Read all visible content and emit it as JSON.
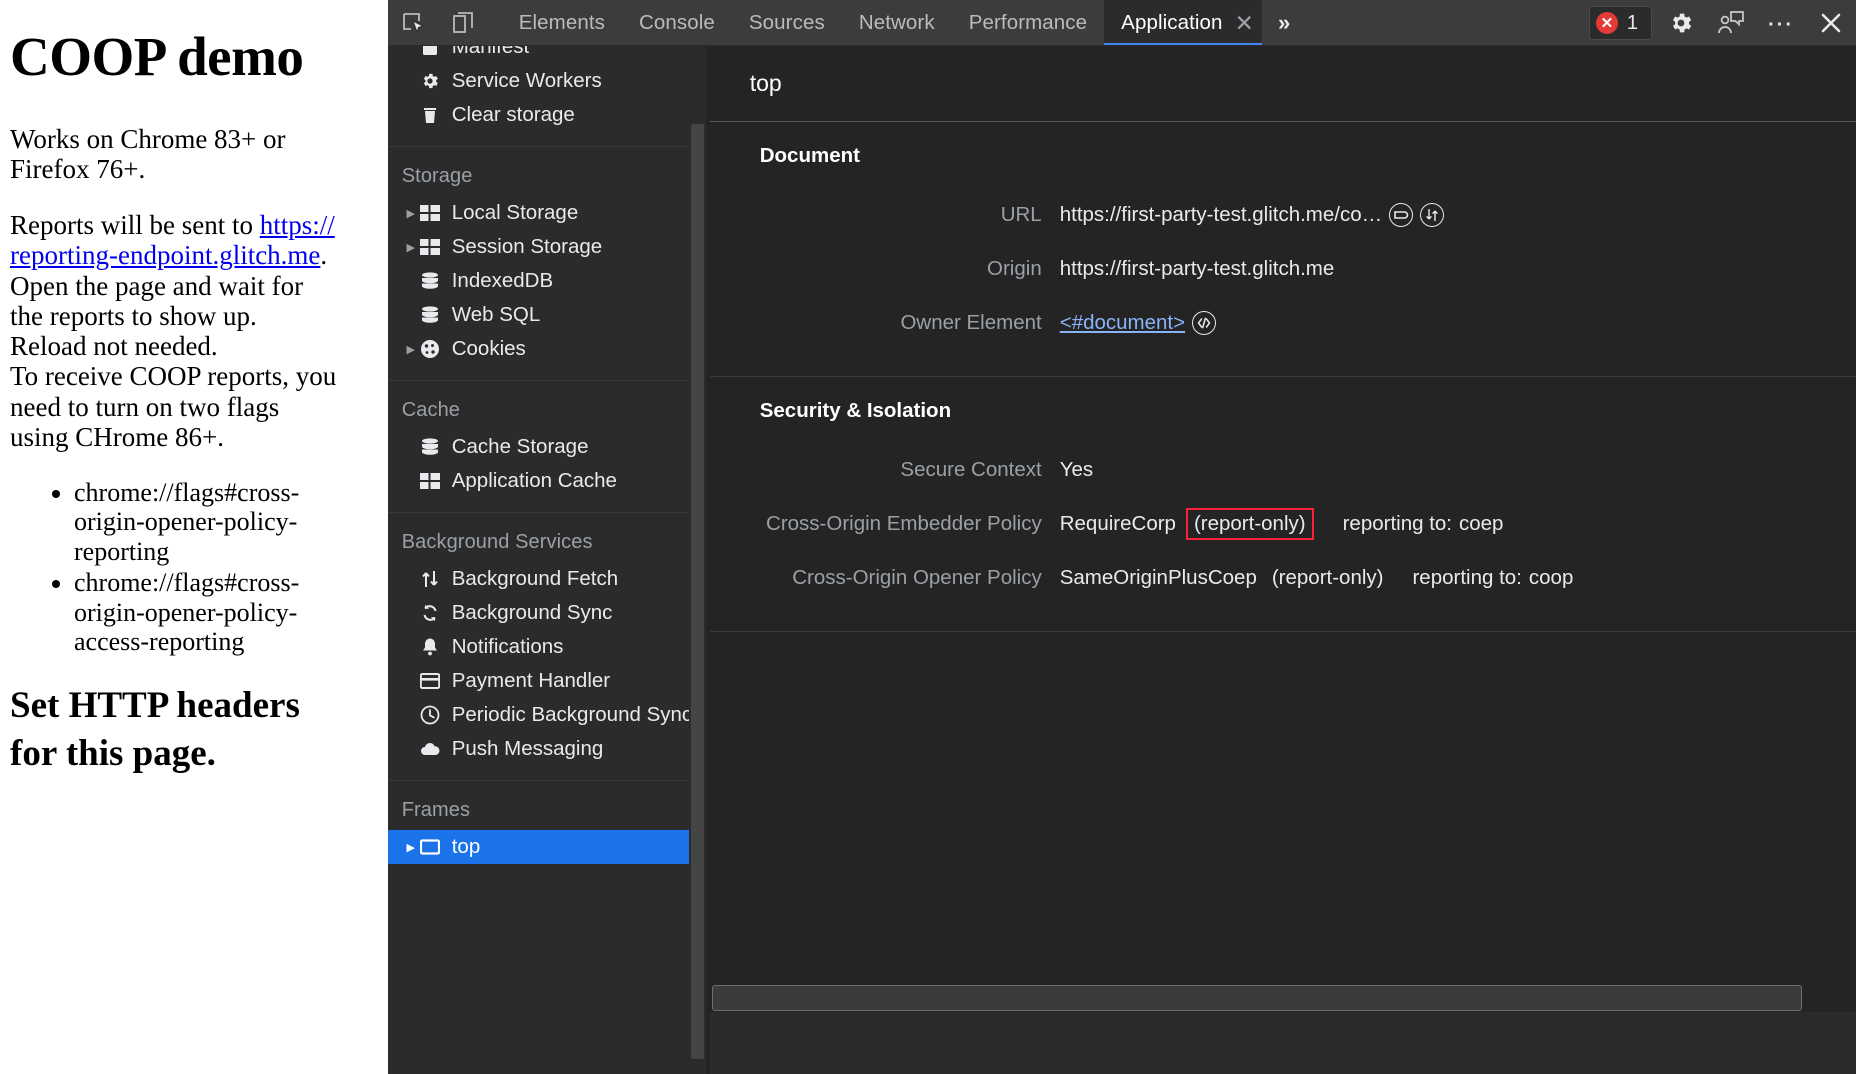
{
  "web_page": {
    "title": "COOP demo",
    "paragraph1": "Works on Chrome 83+ or Firefox 76+.",
    "reports_prefix": "Reports will be sent to ",
    "reports_link": "https://reporting-endpoint.glitch.me",
    "reports_suffix": ".",
    "line_open": "Open the page and wait for the reports to show up.",
    "line_reload": "Reload not needed.",
    "line_flags": "To receive COOP reports, you need to turn on two flags using CHrome 86+.",
    "flags": [
      "chrome://flags#cross-origin-opener-policy-reporting",
      "chrome://flags#cross-origin-opener-policy-access-reporting"
    ],
    "heading2": "Set HTTP headers for this page."
  },
  "devtools": {
    "toolbar": {
      "inspect_icon": "inspect-element-icon",
      "device_icon": "device-toolbar-icon",
      "tabs": [
        {
          "label": "Elements",
          "active": false
        },
        {
          "label": "Console",
          "active": false
        },
        {
          "label": "Sources",
          "active": false
        },
        {
          "label": "Network",
          "active": false
        },
        {
          "label": "Performance",
          "active": false
        },
        {
          "label": "Application",
          "active": true
        }
      ],
      "more_tabs": "»",
      "error_count": "1",
      "settings_icon": "gear-icon",
      "feedback_icon": "feedback-person-icon",
      "more_icon": "more-options-icon",
      "close_icon": "close-icon",
      "accent": "#4285f4",
      "error_color": "#e53935"
    },
    "sidebar": {
      "groups": [
        {
          "title": "",
          "items": [
            {
              "label": "Manifest",
              "icon": "manifest-icon",
              "arrow": false,
              "selected": false
            },
            {
              "label": "Service Workers",
              "icon": "gear-icon",
              "arrow": false,
              "selected": false
            },
            {
              "label": "Clear storage",
              "icon": "trash-icon",
              "arrow": false,
              "selected": false
            }
          ]
        },
        {
          "title": "Storage",
          "items": [
            {
              "label": "Local Storage",
              "icon": "table-icon",
              "arrow": true,
              "selected": false
            },
            {
              "label": "Session Storage",
              "icon": "table-icon",
              "arrow": true,
              "selected": false
            },
            {
              "label": "IndexedDB",
              "icon": "database-icon",
              "arrow": false,
              "selected": false
            },
            {
              "label": "Web SQL",
              "icon": "database-icon",
              "arrow": false,
              "selected": false
            },
            {
              "label": "Cookies",
              "icon": "cookie-icon",
              "arrow": true,
              "selected": false
            }
          ]
        },
        {
          "title": "Cache",
          "items": [
            {
              "label": "Cache Storage",
              "icon": "database-icon",
              "arrow": false,
              "selected": false
            },
            {
              "label": "Application Cache",
              "icon": "table-icon",
              "arrow": false,
              "selected": false
            }
          ]
        },
        {
          "title": "Background Services",
          "items": [
            {
              "label": "Background Fetch",
              "icon": "updown-arrows-icon",
              "arrow": false,
              "selected": false
            },
            {
              "label": "Background Sync",
              "icon": "sync-icon",
              "arrow": false,
              "selected": false
            },
            {
              "label": "Notifications",
              "icon": "bell-icon",
              "arrow": false,
              "selected": false
            },
            {
              "label": "Payment Handler",
              "icon": "credit-card-icon",
              "arrow": false,
              "selected": false
            },
            {
              "label": "Periodic Background Sync",
              "icon": "clock-icon",
              "arrow": false,
              "selected": false
            },
            {
              "label": "Push Messaging",
              "icon": "cloud-icon",
              "arrow": false,
              "selected": false
            }
          ]
        },
        {
          "title": "Frames",
          "items": [
            {
              "label": "top",
              "icon": "frame-icon",
              "arrow": true,
              "selected": true
            }
          ]
        }
      ]
    },
    "main": {
      "header_title": "top",
      "document_section": {
        "title": "Document",
        "url_label": "URL",
        "url_value": "https://first-party-test.glitch.me/co…",
        "url_icon1": "open-in-sources-icon",
        "url_icon2": "open-in-network-icon",
        "origin_label": "Origin",
        "origin_value": "https://first-party-test.glitch.me",
        "owner_label": "Owner Element",
        "owner_value": "<#document>",
        "owner_icon": "reveal-in-elements-icon"
      },
      "security_section": {
        "title": "Security & Isolation",
        "secure_context_label": "Secure Context",
        "secure_context_value": "Yes",
        "coep_label": "Cross-Origin Embedder Policy",
        "coep_value": "RequireCorp",
        "coep_report_only": "(report-only)",
        "coep_reporting": "reporting to: ",
        "coep_endpoint": "coep",
        "coop_label": "Cross-Origin Opener Policy",
        "coop_value": "SameOriginPlusCoep",
        "coop_report_only": "(report-only)",
        "coop_reporting": "reporting to: ",
        "coop_endpoint": "coop",
        "highlight_color": "#ff1f3d"
      }
    }
  }
}
